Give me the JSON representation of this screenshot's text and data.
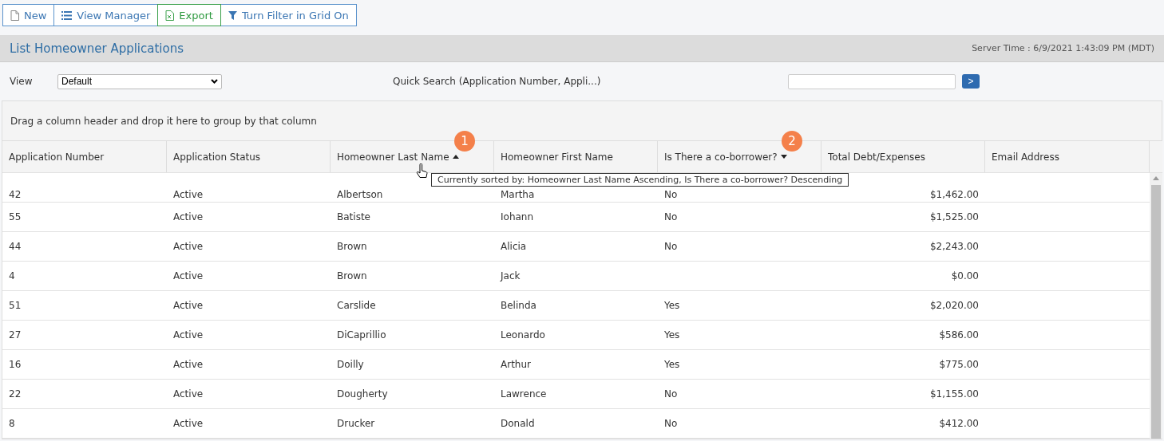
{
  "toolbar": [
    {
      "label": "New",
      "kind": "new"
    },
    {
      "label": "View Manager",
      "kind": "list"
    },
    {
      "label": "Export",
      "kind": "export"
    },
    {
      "label": "Turn Filter in Grid On",
      "kind": "filter"
    }
  ],
  "title": "List Homeowner Applications",
  "server_time": "Server Time : 6/9/2021 1:43:09 PM (MDT)",
  "view": {
    "label": "View",
    "value": "Default"
  },
  "quick_search": {
    "label": "Quick Search (Application Number, Appli...)",
    "button": ">"
  },
  "group_hint": "Drag a column header and drop it here to group by that column",
  "table": {
    "columns": [
      {
        "label": "Application Number",
        "sorted": false
      },
      {
        "label": "Application Status",
        "sorted": false
      },
      {
        "label": "Homeowner Last Name",
        "sorted": true,
        "descending": false,
        "badge": "1"
      },
      {
        "label": "Homeowner First Name",
        "sorted": false
      },
      {
        "label": "Is There a co-borrower?",
        "sorted": true,
        "descending": true,
        "badge": "2"
      },
      {
        "label": "Total Debt/Expenses",
        "sorted": false,
        "numeric": true
      },
      {
        "label": "Email Address",
        "sorted": false
      }
    ],
    "rows": [
      [
        "42",
        "Active",
        "Albertson",
        "Martha",
        "No",
        "$1,462.00",
        ""
      ],
      [
        "55",
        "Active",
        "Batiste",
        "Iohann",
        "No",
        "$1,525.00",
        ""
      ],
      [
        "44",
        "Active",
        "Brown",
        "Alicia",
        "No",
        "$2,243.00",
        ""
      ],
      [
        "4",
        "Active",
        "Brown",
        "Jack",
        "",
        "$0.00",
        ""
      ],
      [
        "51",
        "Active",
        "Carslide",
        "Belinda",
        "Yes",
        "$2,020.00",
        ""
      ],
      [
        "27",
        "Active",
        "DiCaprillio",
        "Leonardo",
        "Yes",
        "$586.00",
        ""
      ],
      [
        "16",
        "Active",
        "Doilly",
        "Arthur",
        "Yes",
        "$775.00",
        ""
      ],
      [
        "22",
        "Active",
        "Dougherty",
        "Lawrence",
        "No",
        "$1,155.00",
        ""
      ],
      [
        "8",
        "Active",
        "Drucker",
        "Donald",
        "No",
        "$412.00",
        ""
      ]
    ]
  },
  "tooltip": "Currently sorted by: Homeowner Last Name Ascending, Is There a co-borrower? Descending"
}
